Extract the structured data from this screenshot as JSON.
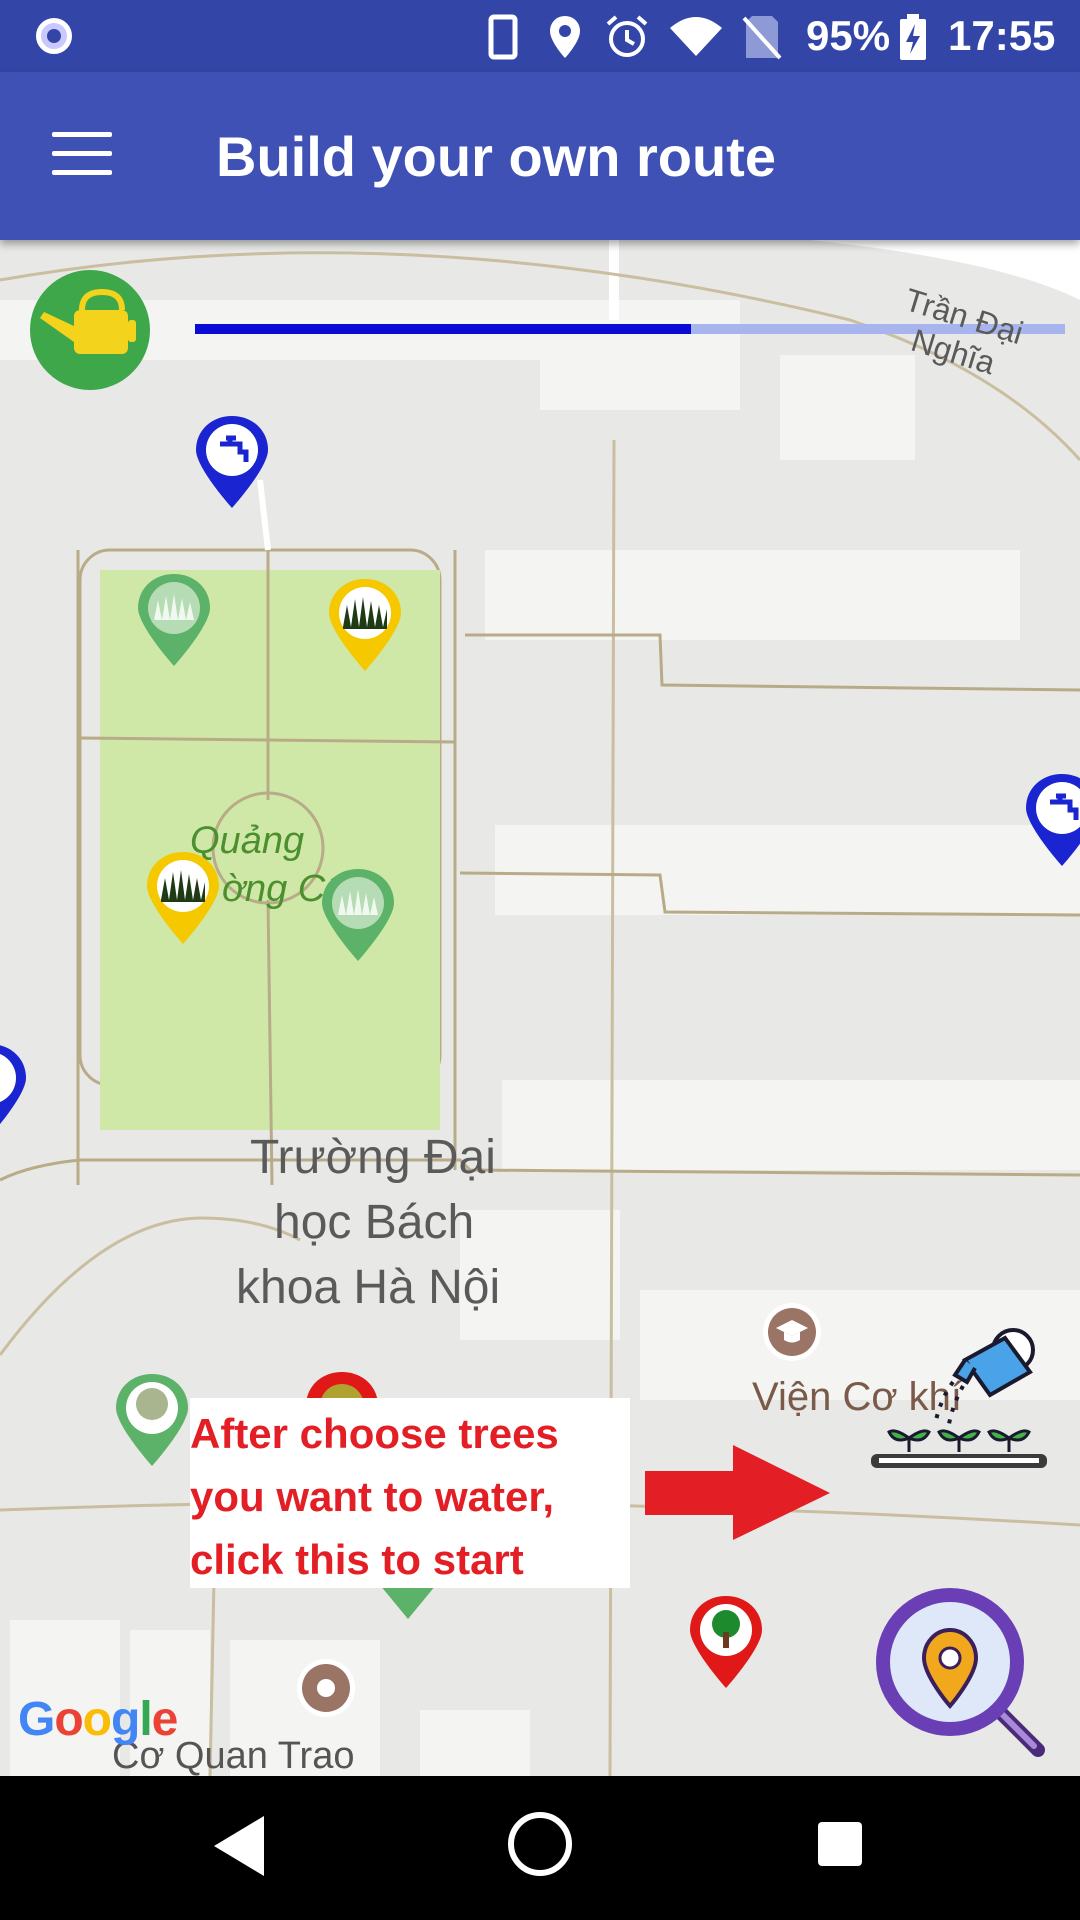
{
  "status_bar": {
    "battery_percent": "95%",
    "time": "17:55",
    "icons": [
      "notification-dot-icon",
      "phone-icon",
      "location-icon",
      "alarm-icon",
      "wifi-icon",
      "no-sim-icon",
      "battery-charging-icon"
    ]
  },
  "app_bar": {
    "title": "Build your own route",
    "menu_icon": "hamburger-menu-icon"
  },
  "map": {
    "street_label": "Trần Đại Nghĩa",
    "park_label_line1": "Quảng",
    "park_label_line2": "ờng C1",
    "campus_label_line1": "Trường Đại",
    "campus_label_line2": "học Bách",
    "campus_label_line3": "khoa Hà Nội",
    "institute_label": "Viện Cơ khí",
    "bottom_label": "Cơ Quan Trao",
    "google_logo": "Google",
    "progress_fraction": 0.57
  },
  "annotation": {
    "line1": "After choose trees",
    "line2": "you want to water,",
    "line3": "click this to start"
  },
  "colors": {
    "status_bar": "#3346a8",
    "app_bar": "#3f51b5",
    "progress_fill": "#0b0bd6",
    "park": "#cfe8a7",
    "pin_green": "#5bb268",
    "pin_yellow": "#f6c800",
    "pin_blue": "#1a24d0",
    "pin_red": "#e01818",
    "annotation_text": "#e31e24"
  }
}
